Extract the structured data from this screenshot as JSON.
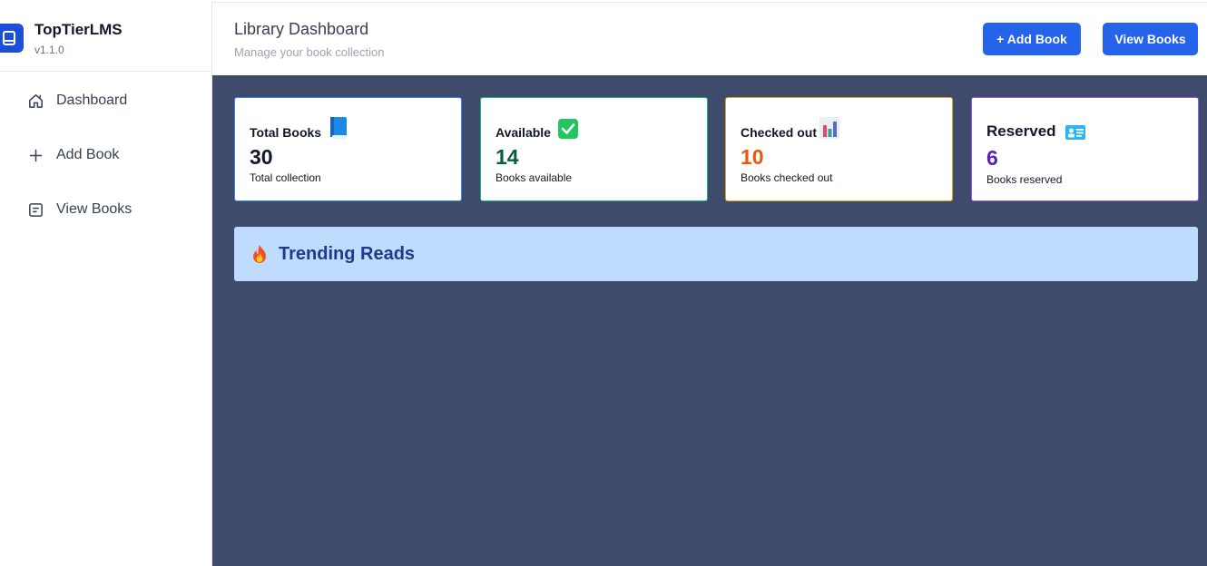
{
  "app": {
    "name": "TopTierLMS",
    "version": "v1.1.0"
  },
  "sidebar": {
    "items": [
      {
        "label": "Dashboard",
        "icon": "home-icon"
      },
      {
        "label": "Add Book",
        "icon": "plus-icon"
      },
      {
        "label": "View Books",
        "icon": "list-icon"
      }
    ]
  },
  "header": {
    "title": "Library Dashboard",
    "subtitle": "Manage your book collection",
    "add_book_label": "+ Add Book",
    "view_books_label": "View Books"
  },
  "stats": [
    {
      "title": "Total Books",
      "value": "30",
      "subtitle": "Total collection",
      "icon": "blue-book-icon",
      "border_color": "#3b82f6",
      "value_color": "#111827"
    },
    {
      "title": "Available",
      "value": "14",
      "subtitle": "Books available",
      "icon": "check-mark-icon",
      "border_color": "#10b981",
      "value_color": "#065f46"
    },
    {
      "title": "Checked out",
      "value": "10",
      "subtitle": "Books checked out",
      "icon": "bar-chart-icon",
      "border_color": "#f59e0b",
      "value_color": "#ea580c"
    },
    {
      "title": "Reserved",
      "value": "6",
      "subtitle": "Books reserved",
      "icon": "id-card-icon",
      "border_color": "#8b5cf6",
      "value_color": "#5b21b6"
    }
  ],
  "trending": {
    "title": "Trending Reads",
    "icon": "fire-icon"
  },
  "colors": {
    "accent": "#2563eb",
    "main_background": "#3f4b6b",
    "trending_background": "#bfdbfe",
    "trending_text": "#1e3a8a"
  }
}
